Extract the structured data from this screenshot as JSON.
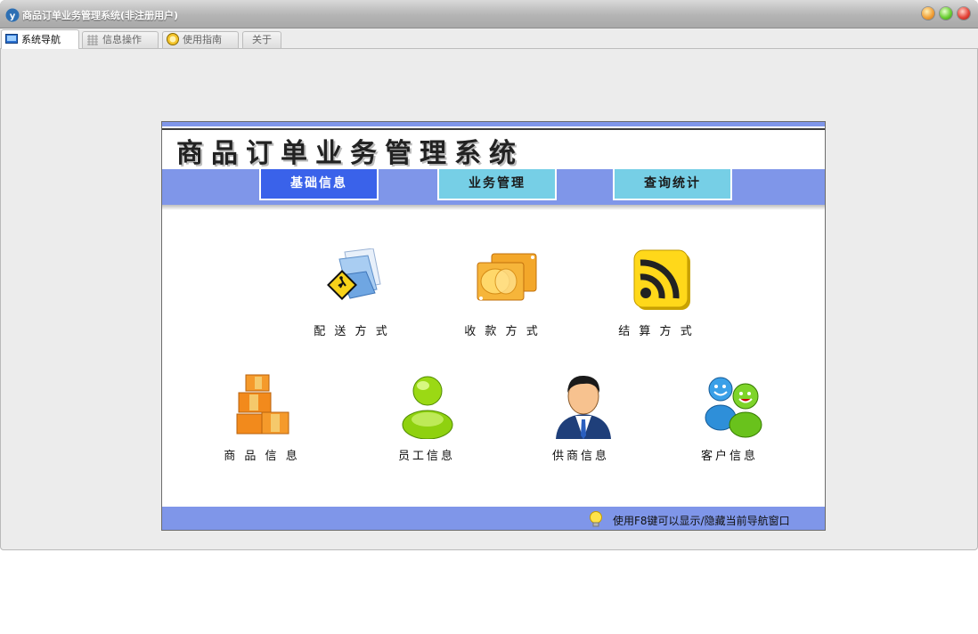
{
  "window": {
    "title": "商品订单业务管理系统(非注册用户)"
  },
  "tabs": [
    {
      "label": "系统导航",
      "icon": "monitor-icon",
      "active": true
    },
    {
      "label": "信息操作",
      "icon": "grid-icon",
      "active": false
    },
    {
      "label": "使用指南",
      "icon": "help-icon",
      "active": false
    },
    {
      "label": "关于",
      "icon": "",
      "active": false
    }
  ],
  "panel": {
    "title": "商品订单业务管理系统",
    "menu": [
      {
        "label": "基础信息",
        "active": true
      },
      {
        "label": "业务管理",
        "active": false
      },
      {
        "label": "查询统计",
        "active": false
      }
    ],
    "items_row1": [
      {
        "label": "配 送 方 式",
        "icon": "folder-sign-icon"
      },
      {
        "label": "收 款 方 式",
        "icon": "gold-cards-icon"
      },
      {
        "label": "结 算 方 式",
        "icon": "rss-icon"
      }
    ],
    "items_row2": [
      {
        "label": "商 品 信 息",
        "icon": "boxes-icon"
      },
      {
        "label": "员工信息",
        "icon": "user-green-icon"
      },
      {
        "label": "供商信息",
        "icon": "businessman-icon"
      },
      {
        "label": "客户信息",
        "icon": "users-icon"
      }
    ],
    "footer_hint": "使用F8键可以显示/隐藏当前导航窗口"
  },
  "colors": {
    "accent": "#7f96e9",
    "menu_active": "#3a62ea",
    "menu_inactive": "#76cfe6"
  }
}
